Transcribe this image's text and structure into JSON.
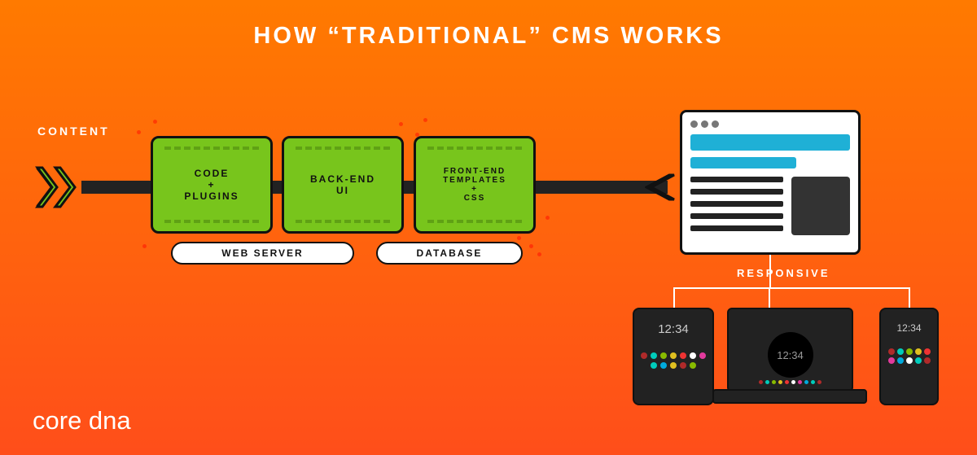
{
  "title": "HOW “TRADITIONAL” CMS WORKS",
  "content_label": "CONTENT",
  "boxes": {
    "b1": "CODE\n+\nPLUGINS",
    "b2": "BACK-END\nUI",
    "b3": "FRONT-END\nTEMPLATES\n+\nCSS"
  },
  "pills": {
    "p1": "WEB SERVER",
    "p2": "DATABASE"
  },
  "responsive_label": "RESPONSIVE",
  "clocks": {
    "tablet": "12:34",
    "laptop": "12:34",
    "phone": "12:34"
  },
  "brand": {
    "part1": "c",
    "part2": "ore",
    "part3": " dna"
  },
  "colors": {
    "green": "#78c51c",
    "teal": "#1fb0d6",
    "orange_top": "#ff7a00",
    "orange_bot": "#ff4e1a"
  }
}
